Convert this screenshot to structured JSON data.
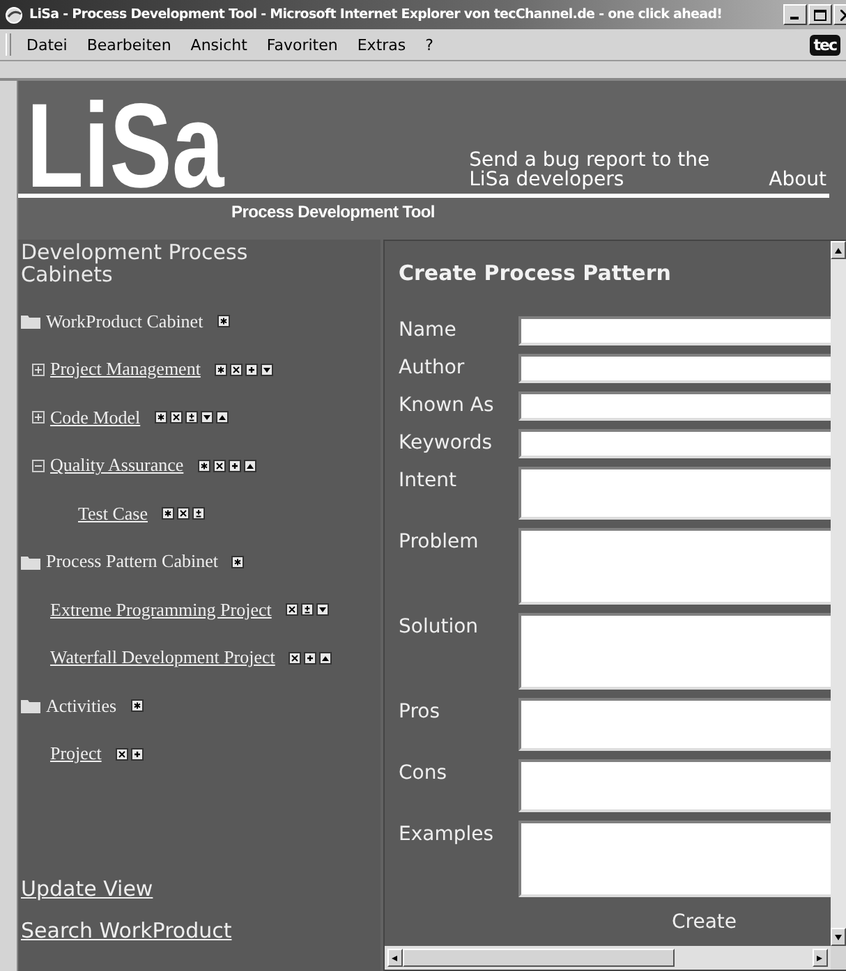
{
  "window": {
    "title": "LiSa - Process Development Tool - Microsoft Internet Explorer von tecChannel.de - one click ahead!"
  },
  "menu": [
    "Datei",
    "Bearbeiten",
    "Ansicht",
    "Favoriten",
    "Extras",
    "?"
  ],
  "brand_badge": "tec",
  "header": {
    "logo": "LiSa",
    "subtitle": "Process Development Tool",
    "links": [
      "Send a bug report to the LiSa developers",
      "About"
    ]
  },
  "sidebar": {
    "heading": "Development Process Cabinets",
    "tree": [
      {
        "label": "WorkProduct Cabinet",
        "kind": "cabinet",
        "icons": [
          {
            "kind": "star"
          }
        ],
        "children": [
          {
            "label": "Project Management",
            "kind": "item",
            "expanded": false,
            "icons": [
              {
                "kind": "star"
              },
              {
                "kind": "cross"
              },
              {
                "kind": "plus"
              },
              {
                "kind": "down"
              }
            ]
          },
          {
            "label": "Code Model",
            "kind": "item",
            "expanded": false,
            "icons": [
              {
                "kind": "star"
              },
              {
                "kind": "cross"
              },
              {
                "kind": "plusminus"
              },
              {
                "kind": "down"
              },
              {
                "kind": "up"
              }
            ]
          },
          {
            "label": "Quality Assurance",
            "kind": "item",
            "expanded": true,
            "icons": [
              {
                "kind": "star"
              },
              {
                "kind": "cross"
              },
              {
                "kind": "plus"
              },
              {
                "kind": "up"
              }
            ],
            "children": [
              {
                "label": "Test Case",
                "kind": "item",
                "icons": [
                  {
                    "kind": "star"
                  },
                  {
                    "kind": "cross"
                  },
                  {
                    "kind": "plusminus"
                  }
                ]
              }
            ]
          }
        ]
      },
      {
        "label": "Process Pattern Cabinet",
        "kind": "cabinet",
        "icons": [
          {
            "kind": "star"
          }
        ],
        "children": [
          {
            "label": "Extreme Programming Project",
            "kind": "item",
            "icons": [
              {
                "kind": "cross"
              },
              {
                "kind": "plusminus"
              },
              {
                "kind": "down"
              }
            ]
          },
          {
            "label": "Waterfall Development Project",
            "kind": "item",
            "icons": [
              {
                "kind": "cross"
              },
              {
                "kind": "plus"
              },
              {
                "kind": "up"
              }
            ]
          }
        ]
      },
      {
        "label": "Activities",
        "kind": "cabinet",
        "icons": [
          {
            "kind": "star"
          }
        ],
        "children": [
          {
            "label": "Project",
            "kind": "item",
            "icons": [
              {
                "kind": "cross"
              },
              {
                "kind": "plus"
              }
            ]
          }
        ]
      }
    ],
    "links": [
      "Update View",
      "Search WorkProduct"
    ]
  },
  "form": {
    "title": "Create Process Pattern",
    "fields": [
      {
        "label": "Name",
        "kind": "line"
      },
      {
        "label": "Author",
        "kind": "line"
      },
      {
        "label": "Known As",
        "kind": "line"
      },
      {
        "label": "Keywords",
        "kind": "line"
      },
      {
        "label": "Intent",
        "kind": "short"
      },
      {
        "label": "Problem",
        "kind": "tall"
      },
      {
        "label": "Solution",
        "kind": "tall"
      },
      {
        "label": "Pros",
        "kind": "short"
      },
      {
        "label": "Cons",
        "kind": "short"
      },
      {
        "label": "Examples",
        "kind": "tall"
      }
    ],
    "submit": "Create"
  }
}
